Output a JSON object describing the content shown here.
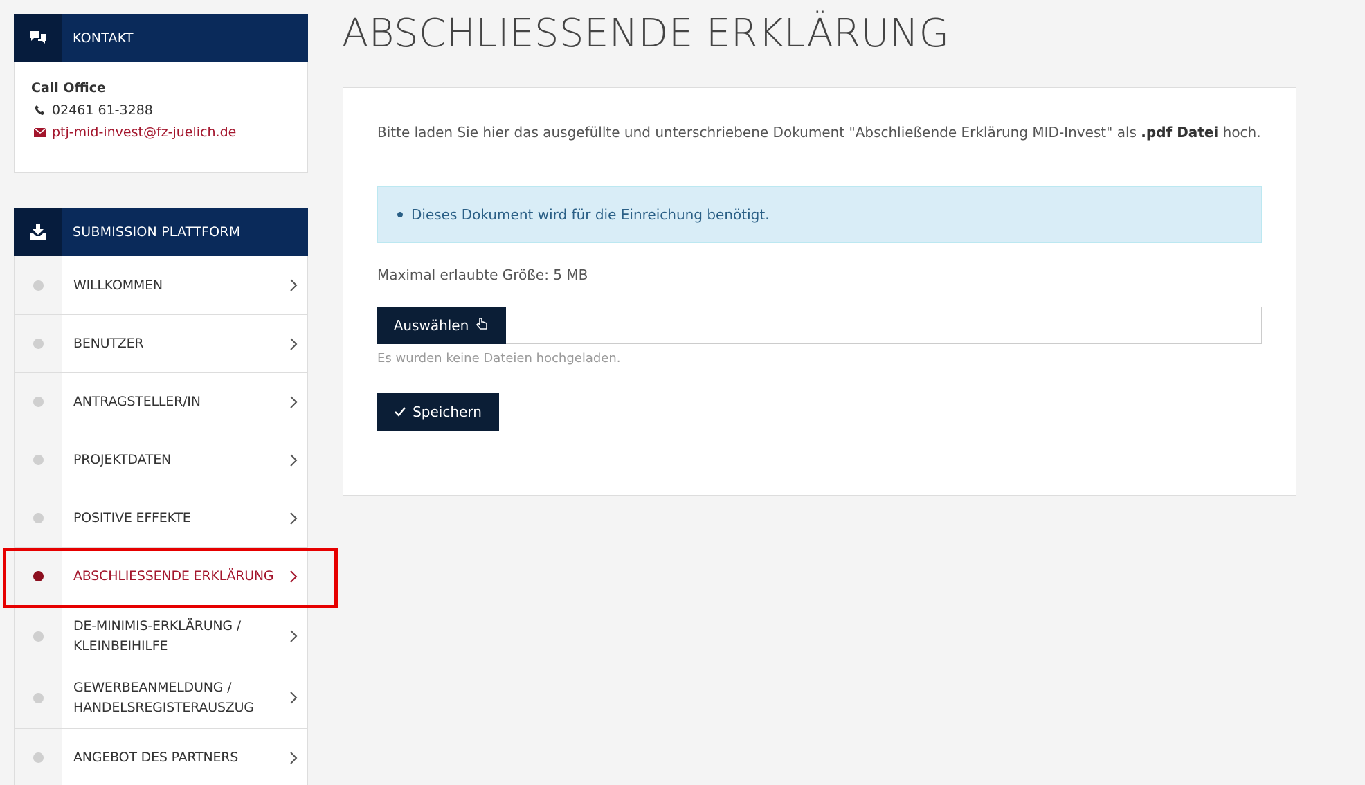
{
  "contact": {
    "header": "KONTAKT",
    "name": "Call Office",
    "phone": "02461 61-3288",
    "email": "ptj-mid-invest@fz-juelich.de"
  },
  "submission": {
    "header": "SUBMISSION PLATTFORM",
    "items": [
      {
        "label": "WILLKOMMEN"
      },
      {
        "label": "BENUTZER"
      },
      {
        "label": "ANTRAGSTELLER/IN"
      },
      {
        "label": "PROJEKTDATEN"
      },
      {
        "label": "POSITIVE EFFEKTE"
      },
      {
        "label": "ABSCHLIESSENDE ERKLÄRUNG"
      },
      {
        "label": "DE-MINIMIS-ERKLÄRUNG / KLEINBEIHILFE"
      },
      {
        "label": "GEWERBEANMELDUNG / HANDELSREGISTERAUSZUG"
      },
      {
        "label": "ANGEBOT DES PARTNERS"
      }
    ]
  },
  "main": {
    "title": "ABSCHLIESSENDE ERKLÄRUNG",
    "intro_before": "Bitte laden Sie hier das ausgefüllte und unterschriebene Dokument \"Abschließende Erklärung MID-Invest\" als ",
    "intro_bold": ".pdf Datei",
    "intro_after": " hoch.",
    "info": "Dieses Dokument wird für die Einreichung benötigt.",
    "max_size": "Maximal erlaubte Größe: 5 MB",
    "choose_label": "Auswählen",
    "no_files": "Es wurden keine Dateien hochgeladen.",
    "save_label": "Speichern"
  },
  "colors": {
    "header": "#0a2a5a",
    "active": "#a3152c",
    "button": "#0b1e36",
    "info_bg": "#d9edf7"
  }
}
